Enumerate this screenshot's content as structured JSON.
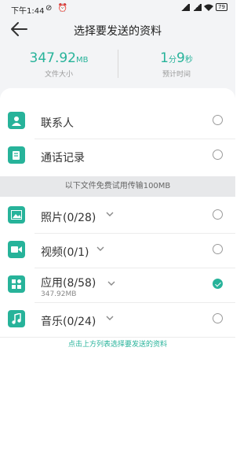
{
  "status": {
    "time": "下午1:44",
    "battery": "79"
  },
  "header": {
    "title": "选择要发送的资料"
  },
  "stats": {
    "file_size_value": "347.92",
    "file_size_unit": "MB",
    "file_size_label": "文件大小",
    "time_min": "1",
    "time_min_unit": "分",
    "time_sec": "9",
    "time_sec_unit": "秒",
    "time_label": "预计时间"
  },
  "items": [
    {
      "label": "联系人",
      "checked": false,
      "icon": "contact-icon"
    },
    {
      "label": "通话记录",
      "checked": false,
      "icon": "call-log-icon"
    }
  ],
  "banner": "以下文件免费试用传输100MB",
  "files": [
    {
      "label": "照片(0/28)",
      "sub": "",
      "checked": false,
      "icon": "photo-icon"
    },
    {
      "label": "视频(0/1)",
      "sub": "",
      "checked": false,
      "icon": "video-icon"
    },
    {
      "label": "应用(8/58)",
      "sub": "347.92MB",
      "checked": true,
      "icon": "app-icon"
    },
    {
      "label": "音乐(0/24)",
      "sub": "",
      "checked": false,
      "icon": "music-icon"
    }
  ],
  "hint": "点击上方列表选择要发送的资料",
  "colors": {
    "accent": "#27b39a"
  }
}
